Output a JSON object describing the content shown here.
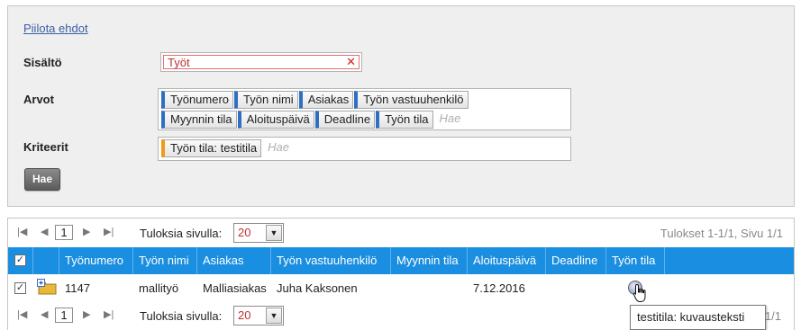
{
  "filter": {
    "hide_link": "Piilota ehdot",
    "content_label": "Sisältö",
    "content_value": "Työt",
    "values_label": "Arvot",
    "value_tags_row1": [
      "Työnumero",
      "Työn nimi",
      "Asiakas",
      "Työn vastuuhenkilö"
    ],
    "value_tags_row2": [
      "Myynnin tila",
      "Aloituspäivä",
      "Deadline",
      "Työn tila"
    ],
    "values_placeholder": "Hae",
    "criteria_label": "Kriteerit",
    "criteria_tags": [
      "Työn tila: testitila"
    ],
    "criteria_placeholder": "Hae",
    "search_button": "Hae"
  },
  "pager": {
    "page": "1",
    "per_page_label": "Tuloksia sivulla:",
    "per_page": "20",
    "summary": "Tulokset 1-1/1, Sivu 1/1"
  },
  "grid": {
    "columns": [
      "Työnumero",
      "Työn nimi",
      "Asiakas",
      "Työn vastuuhenkilö",
      "Myynnin tila",
      "Aloituspäivä",
      "Deadline",
      "Työn tila"
    ],
    "rows": [
      {
        "checked": true,
        "tyonumero": "1147",
        "tyon_nimi": "mallityö",
        "asiakas": "Malliasiakas",
        "vastuuhenkilo": "Juha Kaksonen",
        "myynnin_tila": "",
        "aloituspaiva": "7.12.2016",
        "deadline": "",
        "tyon_tila_icon": "status-dot-icon"
      }
    ]
  },
  "bottom_summary_partial": "1/1",
  "tooltip": "testitila: kuvausteksti",
  "colors": {
    "header_blue": "#1a8ee0",
    "tag_blue": "#2f6fc1",
    "tag_orange": "#f09a18",
    "accent_red": "#c03030"
  }
}
